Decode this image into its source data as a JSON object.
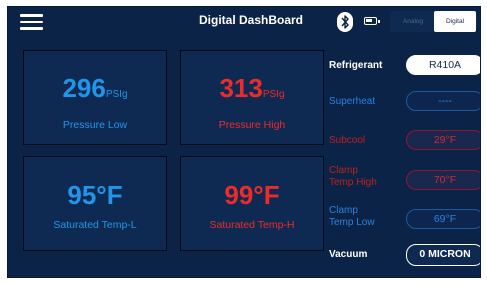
{
  "header": {
    "title": "Digital DashBoard",
    "analog_label": "Analog",
    "digital_label": "Digital"
  },
  "gauges": [
    {
      "value": "296",
      "unit": "PSIg",
      "label": "Pressure Low",
      "color": "#2196e8"
    },
    {
      "value": "313",
      "unit": "PSIg",
      "label": "Pressure High",
      "color": "#ee2b2b"
    },
    {
      "value": "95°F",
      "label": "Saturated Temp-L",
      "color": "#2196e8"
    },
    {
      "value": "99°F",
      "label": "Saturated Temp-H",
      "color": "#ee2b2b"
    }
  ],
  "readings": {
    "refrigerant": {
      "label": "Refrigerant",
      "value": "R410A"
    },
    "superheat": {
      "label": "Superheat",
      "value": "----"
    },
    "subcool": {
      "label": "Subcool",
      "value": "29°F"
    },
    "clamp_high": {
      "label_line1": "Clamp",
      "label_line2": "Temp High",
      "value": "70°F"
    },
    "clamp_low": {
      "label_line1": "Clamp",
      "label_line2": "Temp Low",
      "value": "69°F"
    },
    "vacuum": {
      "label": "Vacuum",
      "value": "0 MICRON"
    }
  },
  "icons": {
    "menu": "hamburger-menu-icon",
    "bluetooth": "bluetooth-icon",
    "battery": "battery-icon"
  },
  "colors": {
    "background": "#0b2347",
    "panel": "#0e2a52",
    "low_side": "#2196e8",
    "high_side": "#ee2b2b"
  }
}
